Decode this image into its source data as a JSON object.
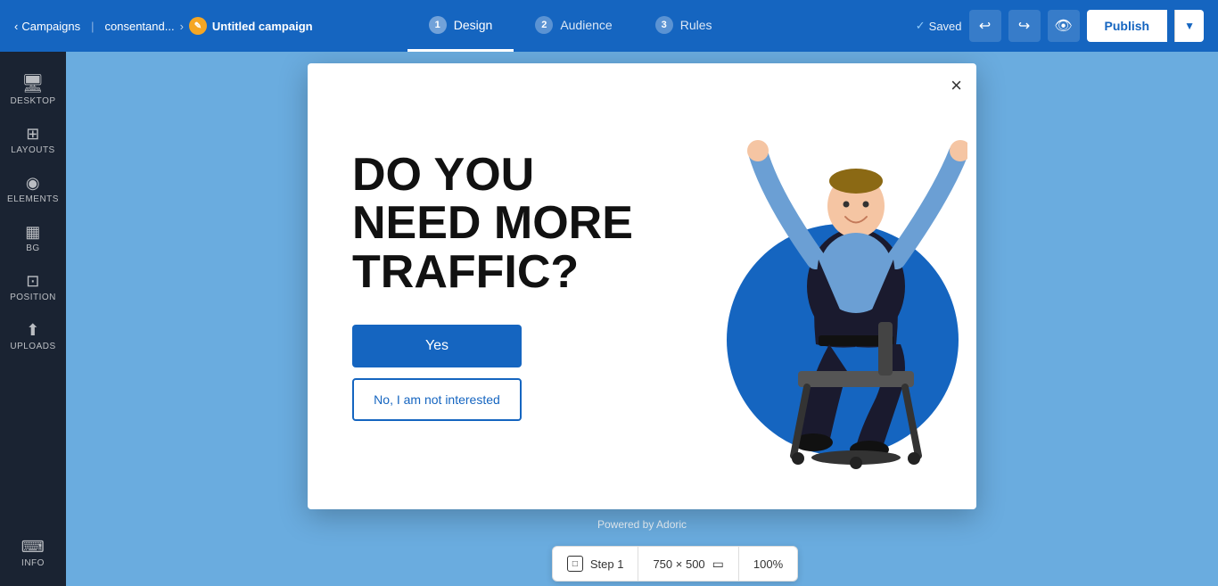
{
  "topnav": {
    "back_label": "Campaigns",
    "breadcrumb1": "consentand...",
    "breadcrumb2": "Untitled campaign",
    "tabs": [
      {
        "num": "1",
        "label": "Design",
        "active": true
      },
      {
        "num": "2",
        "label": "Audience",
        "active": false
      },
      {
        "num": "3",
        "label": "Rules",
        "active": false
      }
    ],
    "saved_label": "Saved",
    "publish_label": "Publish"
  },
  "sidebar": {
    "items": [
      {
        "id": "desktop",
        "icon": "🖥",
        "label": "DESKTOP"
      },
      {
        "id": "layouts",
        "icon": "⊞",
        "label": "LAYOUTS"
      },
      {
        "id": "elements",
        "icon": "◉",
        "label": "ELEMENTS"
      },
      {
        "id": "bg",
        "icon": "▦",
        "label": "BG"
      },
      {
        "id": "position",
        "icon": "⊡",
        "label": "POSITION"
      },
      {
        "id": "uploads",
        "icon": "⬆",
        "label": "UPLOADS"
      },
      {
        "id": "info",
        "icon": "⌨",
        "label": "INFO"
      }
    ]
  },
  "popup": {
    "close_label": "×",
    "headline": "DO YOU NEED MORE TRAFFIC?",
    "btn_yes": "Yes",
    "btn_no": "No, I am not interested"
  },
  "powered_by": "Powered by Adoric",
  "bottom_bar": {
    "step_label": "Step 1",
    "dimensions": "750 × 500",
    "zoom": "100%"
  }
}
